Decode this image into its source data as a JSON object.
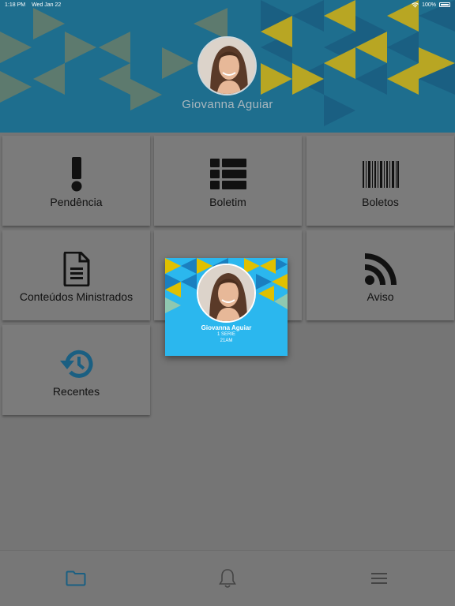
{
  "status_bar": {
    "time": "1:18 PM",
    "date": "Wed Jan 22",
    "battery": "100%"
  },
  "header": {
    "user_name": "Giovanna Aguiar",
    "avatar_icon": "student-photo"
  },
  "tiles": [
    {
      "label": "Pendência",
      "icon": "exclamation-icon"
    },
    {
      "label": "Boletim",
      "icon": "grid-list-icon"
    },
    {
      "label": "Boletos",
      "icon": "barcode-icon"
    },
    {
      "label": "Conteúdos Ministrados",
      "icon": "document-icon"
    },
    {
      "label": "",
      "icon": "obscured-icon"
    },
    {
      "label": "Aviso",
      "icon": "rss-icon"
    },
    {
      "label": "Recentes",
      "icon": "history-icon"
    }
  ],
  "student_card": {
    "name": "Giovanna Aguiar",
    "grade": "1 SERIE",
    "class": "21AM"
  },
  "bottom_nav": [
    {
      "icon": "folder-icon",
      "active": true
    },
    {
      "icon": "bell-icon",
      "active": false
    },
    {
      "icon": "menu-icon",
      "active": false
    }
  ],
  "colors": {
    "header_bg": "#1e6e8e",
    "accent_blue": "#2bb7ee",
    "accent_yellow": "#e0c000",
    "active_nav": "#1a5f82"
  }
}
